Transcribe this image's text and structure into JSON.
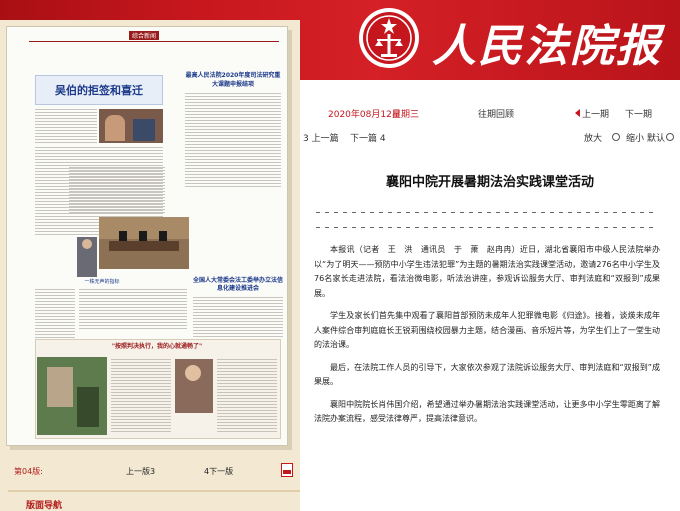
{
  "masthead": {
    "title": "人民法院报"
  },
  "thumbnail": {
    "section_label": "综合新闻",
    "headline": "吴伯的拒签和喜迁",
    "right_headline": "最高人民法院2020年度司法研究重大课题申报结项",
    "box_headline": "全国人大常委会法工委举办立法信息化建设推进会",
    "mid_headline": "一株无声的指标",
    "bottom_headline": "\"按照判决执行，我的心就通畅了\""
  },
  "pager": {
    "current": "第04版:",
    "prev": "上一版3",
    "next": "4下一版"
  },
  "nav": {
    "label": "版面导航"
  },
  "date_bar": {
    "date": "2020年08月12日",
    "weekday": "星期三",
    "history": "往期回顾",
    "prev_issue": "上一期",
    "next_issue": "下一期"
  },
  "tools": {
    "prev_article": "3 上一篇",
    "next_article": "下一篇 4",
    "enlarge": "放大",
    "shrink": "缩小",
    "reset": "默认"
  },
  "article": {
    "title": "襄阳中院开展暑期法治实践课堂活动",
    "paragraphs": [
      "本报讯（记者　王　洪　通讯员　于　萧　赵冉冉）近日，湖北省襄阳市中级人民法院举办以“为了明天——预防中小学生违法犯罪”为主题的暑期法治实践课堂活动，邀请276名中小学生及76名家长走进法院，看法治微电影，听法治讲座，参观诉讼服务大厅、审判法庭和“双报到”成果展。",
      "学生及家长们首先集中观看了襄阳首部预防未成年人犯罪微电影《归途》。接着，谈煐未成年人案件综合审判庭庭长王锐莉围绕校园暴力主题，结合漫画、音乐短片等，为学生们上了一堂生动的法治课。",
      "最后，在法院工作人员的引导下，大家依次参观了法院诉讼服务大厅、审判法庭和“双报到”成果展。",
      "襄阳中院院长肖伟国介绍，希望通过举办暑期法治实践课堂活动，让更多中小学生零距离了解法院办案流程，感受法律尊严，提高法律意识。"
    ]
  },
  "colors": {
    "brand_red": "#c4161c",
    "panel_beige": "#f3e9d2",
    "headline_blue": "#1c3a8a"
  }
}
